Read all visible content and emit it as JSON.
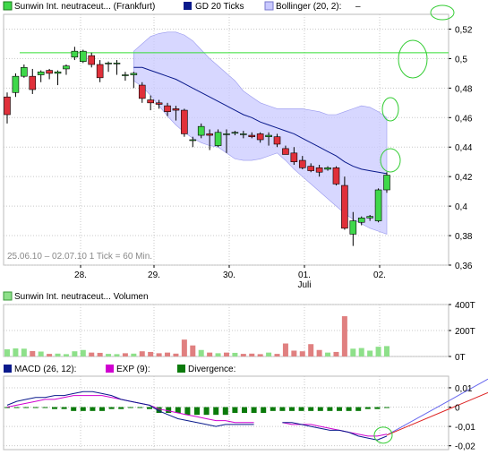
{
  "colors": {
    "up": "#3fd84a",
    "down": "#e0303a",
    "ma": "#0a1a8c",
    "band": "#c9c9ff",
    "band_edge": "#9999ee",
    "volume_up": "#8ee08a",
    "volume_down": "#e08080",
    "macd": "#0a1a8c",
    "exp": "#d000d0",
    "divergence": "#0b7a0b",
    "hline": "#33dd33",
    "circle": "#33cc33",
    "grid": "#c8c8c8"
  },
  "legend_main": [
    {
      "label": "Sunwin Int. neutraceut... (Frankfurt)",
      "swatch": "up"
    },
    {
      "label": "GD 20 Ticks",
      "swatch": "ma"
    },
    {
      "label": "Bollinger (20, 2):",
      "swatch": "band"
    },
    {
      "label": "–",
      "swatch": ""
    }
  ],
  "legend_volume": [
    {
      "label": "Sunwin Int. neutraceut... Volumen",
      "swatch": "volume_up"
    }
  ],
  "legend_macd": [
    {
      "label": "MACD (26, 12):",
      "swatch": "macd"
    },
    {
      "label": "EXP (9):",
      "swatch": "exp"
    },
    {
      "label": "Divergence:",
      "swatch": "divergence"
    }
  ],
  "info_text": "25.06.10 – 02.07.10   1 Tick = 60 Min.",
  "chart_data": [
    {
      "type": "candlestick",
      "ylim": [
        0.36,
        0.53
      ],
      "y_ticks": [
        "0,52",
        "0,5",
        "0,48",
        "0,46",
        "0,44",
        "0,42",
        "0,4",
        "0,38",
        "0,36"
      ],
      "x_tick_labels": [
        "28.",
        "29.",
        "30.",
        "01.",
        "02."
      ],
      "x_sublabel": "Juli",
      "reference_line": 0.504,
      "candles": [
        [
          0.474,
          0.477,
          0.456,
          0.462
        ],
        [
          0.477,
          0.49,
          0.474,
          0.488
        ],
        [
          0.488,
          0.496,
          0.487,
          0.494
        ],
        [
          0.488,
          0.493,
          0.476,
          0.479
        ],
        [
          0.489,
          0.492,
          0.484,
          0.491
        ],
        [
          0.492,
          0.493,
          0.486,
          0.49
        ],
        [
          0.49,
          0.492,
          0.482,
          0.491
        ],
        [
          0.493,
          0.496,
          0.489,
          0.495
        ],
        [
          0.501,
          0.508,
          0.499,
          0.505
        ],
        [
          0.498,
          0.506,
          0.497,
          0.505
        ],
        [
          0.502,
          0.504,
          0.494,
          0.496
        ],
        [
          0.496,
          0.499,
          0.484,
          0.487
        ],
        [
          0.497,
          0.498,
          0.491,
          0.497
        ],
        [
          0.497,
          0.499,
          0.489,
          0.497
        ],
        [
          0.489,
          0.491,
          0.485,
          0.489
        ],
        [
          0.489,
          0.491,
          0.48,
          0.49
        ],
        [
          0.482,
          0.484,
          0.47,
          0.473
        ],
        [
          0.472,
          0.475,
          0.465,
          0.47
        ],
        [
          0.47,
          0.472,
          0.466,
          0.469
        ],
        [
          0.468,
          0.47,
          0.461,
          0.464
        ],
        [
          0.466,
          0.468,
          0.458,
          0.465
        ],
        [
          0.465,
          0.466,
          0.447,
          0.449
        ],
        [
          0.445,
          0.447,
          0.44,
          0.445
        ],
        [
          0.448,
          0.456,
          0.446,
          0.454
        ],
        [
          0.449,
          0.452,
          0.438,
          0.448
        ],
        [
          0.441,
          0.452,
          0.44,
          0.45
        ],
        [
          0.449,
          0.452,
          0.436,
          0.449
        ],
        [
          0.45,
          0.451,
          0.448,
          0.45
        ],
        [
          0.449,
          0.451,
          0.446,
          0.449
        ],
        [
          0.448,
          0.45,
          0.446,
          0.447
        ],
        [
          0.449,
          0.45,
          0.443,
          0.445
        ],
        [
          0.447,
          0.45,
          0.441,
          0.448
        ],
        [
          0.447,
          0.449,
          0.44,
          0.442
        ],
        [
          0.439,
          0.441,
          0.436,
          0.435
        ],
        [
          0.436,
          0.44,
          0.428,
          0.43
        ],
        [
          0.431,
          0.434,
          0.425,
          0.426
        ],
        [
          0.427,
          0.429,
          0.423,
          0.424
        ],
        [
          0.426,
          0.428,
          0.42,
          0.423
        ],
        [
          0.425,
          0.427,
          0.424,
          0.426
        ],
        [
          0.426,
          0.427,
          0.414,
          0.415
        ],
        [
          0.414,
          0.42,
          0.384,
          0.385
        ],
        [
          0.381,
          0.396,
          0.373,
          0.39
        ],
        [
          0.389,
          0.393,
          0.387,
          0.392
        ],
        [
          0.392,
          0.394,
          0.39,
          0.393
        ],
        [
          0.39,
          0.412,
          0.389,
          0.411
        ],
        [
          0.411,
          0.423,
          0.409,
          0.421
        ]
      ],
      "ma": [
        null,
        null,
        null,
        null,
        null,
        null,
        null,
        null,
        null,
        null,
        null,
        null,
        null,
        null,
        null,
        0.494,
        0.494,
        0.492,
        0.49,
        0.488,
        0.486,
        0.483,
        0.48,
        0.477,
        0.474,
        0.471,
        0.468,
        0.465,
        0.462,
        0.46,
        0.457,
        0.455,
        0.453,
        0.451,
        0.449,
        0.446,
        0.443,
        0.44,
        0.437,
        0.434,
        0.43,
        0.427,
        0.425,
        0.424,
        0.423,
        0.422
      ],
      "bb_upper": [
        null,
        null,
        null,
        null,
        null,
        null,
        null,
        null,
        null,
        null,
        null,
        null,
        null,
        null,
        null,
        0.505,
        0.51,
        0.515,
        0.517,
        0.518,
        0.518,
        0.516,
        0.512,
        0.506,
        0.5,
        0.495,
        0.49,
        0.485,
        0.478,
        0.474,
        0.47,
        0.468,
        0.466,
        0.466,
        0.466,
        0.466,
        0.465,
        0.464,
        0.462,
        0.462,
        0.464,
        0.466,
        0.468,
        0.467,
        0.464,
        0.46
      ],
      "bb_lower": [
        null,
        null,
        null,
        null,
        null,
        null,
        null,
        null,
        null,
        null,
        null,
        null,
        null,
        null,
        null,
        0.485,
        0.481,
        0.475,
        0.468,
        0.461,
        0.455,
        0.45,
        0.446,
        0.443,
        0.441,
        0.44,
        0.436,
        0.432,
        0.431,
        0.431,
        0.432,
        0.434,
        0.436,
        0.431,
        0.425,
        0.42,
        0.415,
        0.41,
        0.405,
        0.4,
        0.395,
        0.391,
        0.388,
        0.385,
        0.383,
        0.381
      ],
      "annotations": [
        "circle",
        "circle",
        "circle",
        "circle"
      ]
    },
    {
      "type": "bar",
      "title": "Volumen",
      "ylim": [
        0,
        400
      ],
      "y_ticks": [
        "400T",
        "200T",
        "0T"
      ],
      "values": [
        55,
        62,
        60,
        42,
        38,
        20,
        22,
        18,
        40,
        50,
        30,
        28,
        20,
        18,
        25,
        22,
        40,
        35,
        25,
        30,
        22,
        130,
        85,
        50,
        30,
        25,
        30,
        28,
        20,
        22,
        18,
        30,
        20,
        100,
        45,
        40,
        95,
        50,
        30,
        35,
        310,
        60,
        65,
        45,
        75,
        80
      ],
      "up": [
        true,
        true,
        true,
        false,
        true,
        false,
        true,
        true,
        true,
        true,
        false,
        false,
        true,
        true,
        false,
        true,
        false,
        false,
        false,
        false,
        false,
        false,
        false,
        true,
        false,
        true,
        false,
        true,
        false,
        false,
        false,
        true,
        false,
        false,
        false,
        false,
        false,
        false,
        true,
        false,
        false,
        true,
        true,
        true,
        true,
        true
      ]
    },
    {
      "type": "line",
      "title": "MACD",
      "ylim": [
        -0.022,
        0.016
      ],
      "y_ticks": [
        "0,01",
        "0",
        "-0,01",
        "-0,02"
      ],
      "macd": [
        0.001,
        0.003,
        0.004,
        0.005,
        0.005,
        0.006,
        0.006,
        0.007,
        0.008,
        0.008,
        0.007,
        0.006,
        0.004,
        0.003,
        0.002,
        0.001,
        -0.002,
        -0.004,
        -0.006,
        -0.007,
        -0.008,
        -0.009,
        -0.01,
        -0.009,
        -0.009,
        -0.009,
        -0.009,
        null,
        null,
        -0.008,
        -0.008,
        -0.009,
        -0.01,
        -0.011,
        -0.012,
        -0.012,
        -0.013,
        -0.015,
        -0.016,
        -0.017,
        -0.015
      ],
      "exp": [
        0.0,
        0.001,
        0.002,
        0.003,
        0.004,
        0.004,
        0.005,
        0.006,
        0.006,
        0.006,
        0.006,
        0.005,
        0.004,
        0.003,
        0.002,
        0.001,
        -0.001,
        -0.002,
        -0.003,
        -0.004,
        -0.005,
        -0.006,
        -0.007,
        -0.007,
        -0.008,
        -0.008,
        -0.008,
        null,
        null,
        -0.008,
        -0.009,
        -0.009,
        -0.009,
        -0.01,
        -0.011,
        -0.012,
        -0.013,
        -0.014,
        -0.015,
        -0.015,
        -0.014
      ],
      "divergence": [
        0.0,
        0.0,
        0.0,
        0.0,
        0.0,
        -0.001,
        -0.001,
        -0.002,
        -0.002,
        -0.002,
        -0.002,
        -0.001,
        -0.001,
        0.0,
        0.0,
        -0.001,
        -0.003,
        -0.003,
        -0.003,
        -0.004,
        -0.004,
        -0.004,
        -0.004,
        -0.004,
        -0.003,
        -0.003,
        -0.003,
        -0.003,
        -0.002,
        -0.002,
        -0.002,
        -0.002,
        -0.002,
        -0.002,
        -0.002,
        -0.002,
        -0.002,
        -0.002,
        -0.001,
        -0.001,
        0.0
      ],
      "projection_up": [
        -0.0145,
        0.0145
      ],
      "projection_down": [
        -0.0145,
        0.0075
      ]
    }
  ]
}
